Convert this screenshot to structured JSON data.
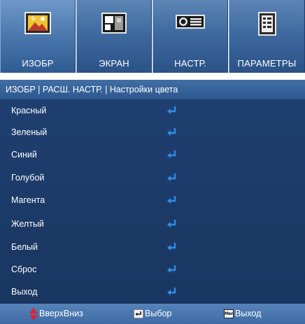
{
  "tabs": [
    {
      "label": "ИЗОБР",
      "icon": "picture-icon",
      "active": true
    },
    {
      "label": "ЭКРАН",
      "icon": "screen-icon",
      "active": false
    },
    {
      "label": "НАСТР.",
      "icon": "projector-icon",
      "active": false
    },
    {
      "label": "ПАРАМЕТРЫ",
      "icon": "options-icon",
      "active": false
    }
  ],
  "breadcrumb": "ИЗОБР | РАСШ. НАСТР. | Настройки цвета",
  "menu": {
    "items": [
      {
        "label": "Красный",
        "icon": "enter-icon"
      },
      {
        "label": "Зеленый",
        "icon": "enter-icon"
      },
      {
        "label": "Синий",
        "icon": "enter-icon"
      },
      {
        "label": "Голубой",
        "icon": "enter-icon"
      },
      {
        "label": "Магента",
        "icon": "enter-icon"
      },
      {
        "label": "Желтый",
        "icon": "enter-icon"
      },
      {
        "label": "Белый",
        "icon": "enter-icon"
      },
      {
        "label": "Сброс",
        "icon": "enter-icon"
      },
      {
        "label": "Выход",
        "icon": "enter-icon"
      }
    ]
  },
  "footer": {
    "updown_label": "ВверхВниз",
    "select_label": "Выбор",
    "menu_key": "Menu",
    "exit_label": "Выход"
  },
  "colors": {
    "accent": "#3e6ba3",
    "list_bg": "#1f3f70",
    "enter_icon": "#2f8ee8",
    "updown_arrow": "#e0203a"
  }
}
